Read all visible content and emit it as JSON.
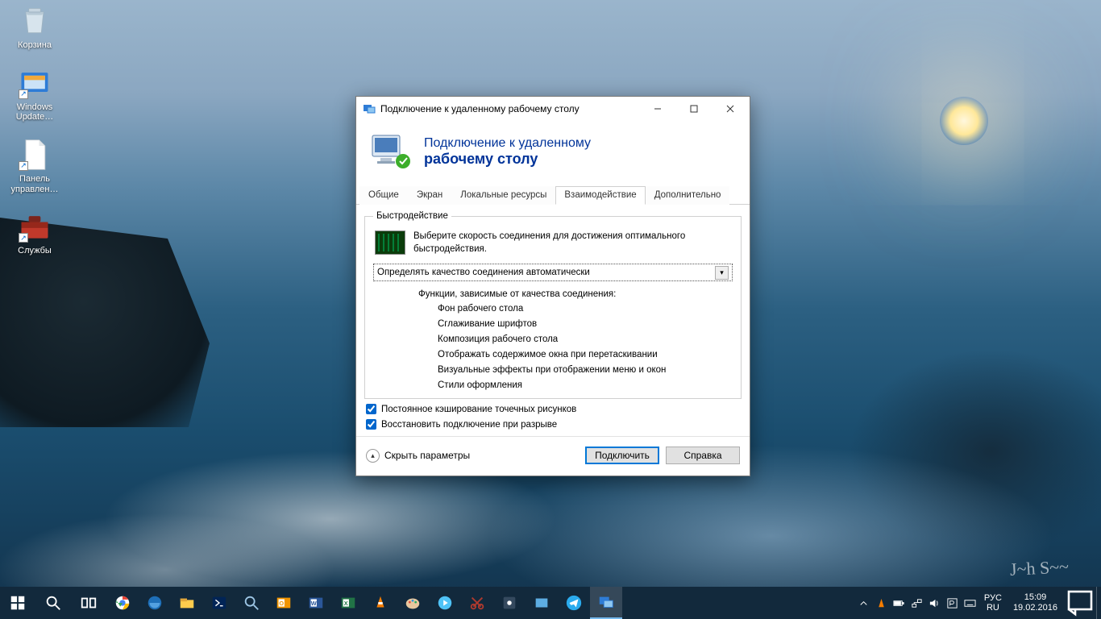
{
  "desktop": {
    "icons": [
      {
        "name": "recycle-bin",
        "label": "Корзина"
      },
      {
        "name": "windows-update",
        "label": "Windows Update…"
      },
      {
        "name": "control-panel",
        "label": "Панель управлен…"
      },
      {
        "name": "services",
        "label": "Службы"
      }
    ]
  },
  "dialog": {
    "title": "Подключение к удаленному рабочему столу",
    "header_line1": "Подключение к удаленному",
    "header_line2": "рабочему столу",
    "tabs": [
      "Общие",
      "Экран",
      "Локальные ресурсы",
      "Взаимодействие",
      "Дополнительно"
    ],
    "active_tab_index": 3,
    "group_legend": "Быстродействие",
    "perf_text": "Выберите скорость соединения для достижения оптимального быстродействия.",
    "combo_value": "Определять качество соединения автоматически",
    "functions_caption": "Функции, зависимые от качества соединения:",
    "functions": [
      "Фон рабочего стола",
      "Сглаживание шрифтов",
      "Композиция рабочего стола",
      "Отображать содержимое окна при перетаскивании",
      "Визуальные эффекты при отображении меню и окон",
      "Стили оформления"
    ],
    "check1_label": "Постоянное кэширование точечных рисунков",
    "check2_label": "Восстановить подключение при разрыве",
    "hide_params_label": "Скрыть параметры",
    "connect_label": "Подключить",
    "help_label": "Справка"
  },
  "taskbar": {
    "lang_top": "РУС",
    "lang_bottom": "RU",
    "time": "15:09",
    "date": "19.02.2016"
  }
}
